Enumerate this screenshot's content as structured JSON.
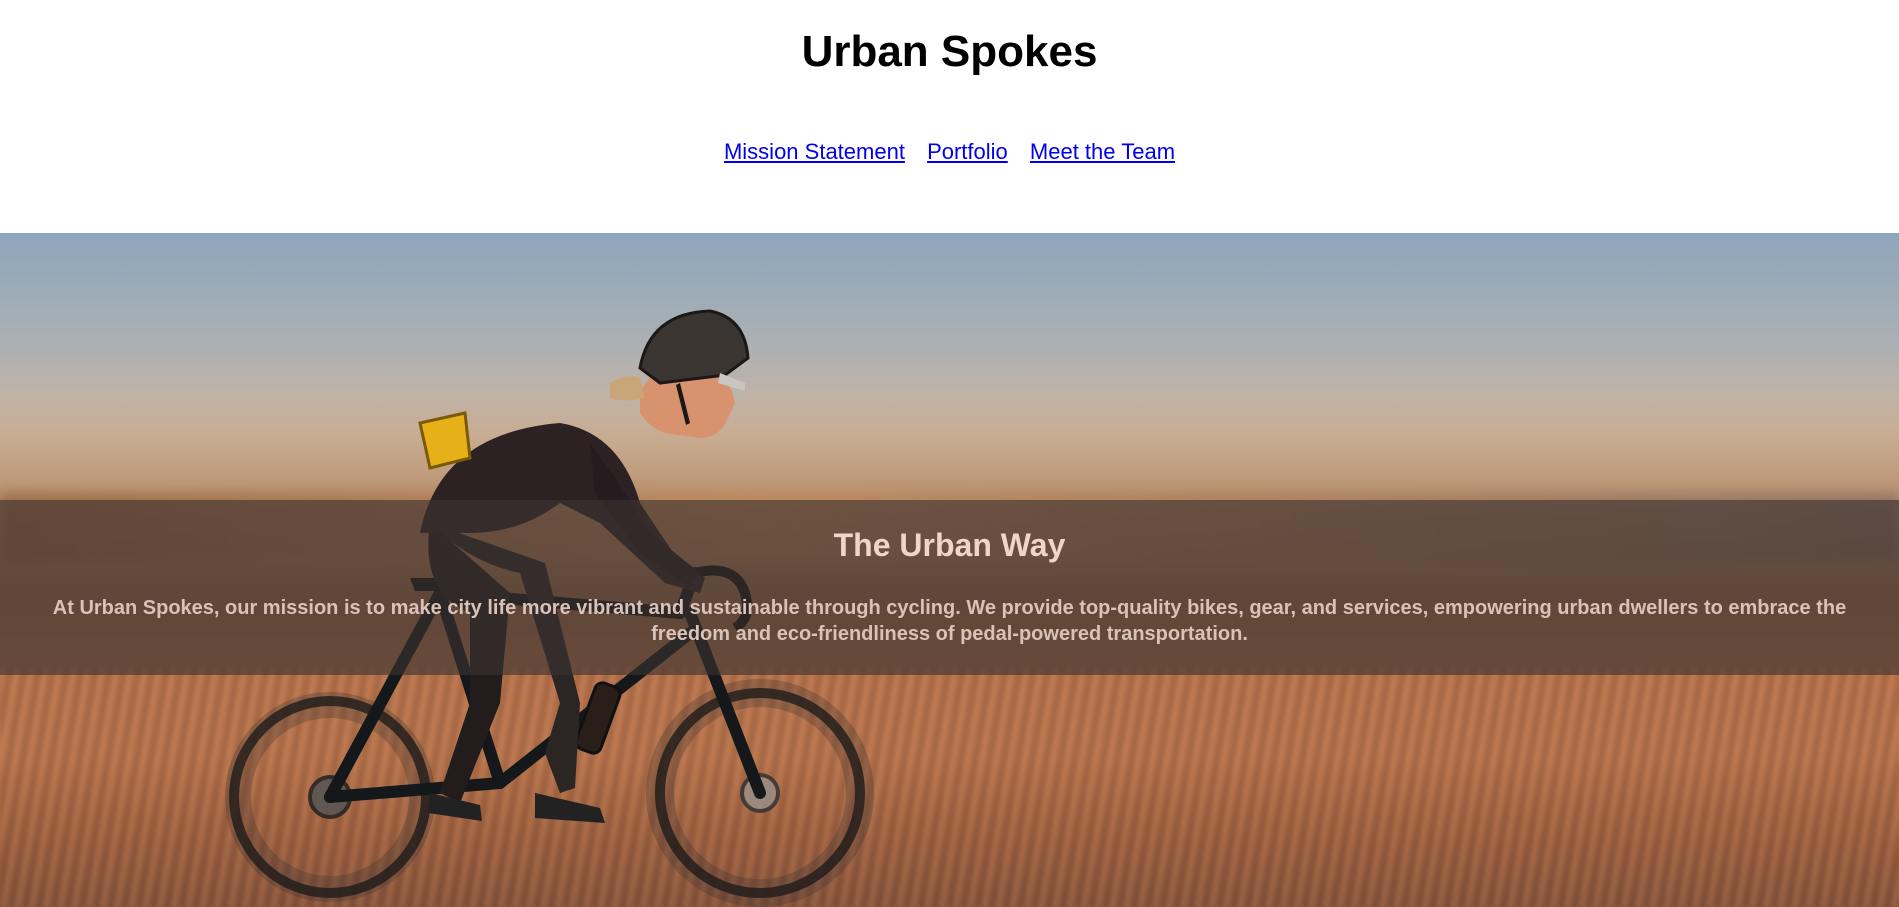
{
  "header": {
    "title": "Urban Spokes"
  },
  "nav": {
    "items": [
      {
        "label": "Mission Statement"
      },
      {
        "label": "Portfolio"
      },
      {
        "label": "Meet the Team"
      }
    ],
    "link_color": "#0000ee"
  },
  "hero": {
    "image_subject": "cyclist-riding-gravel-bike-at-sunset",
    "heading": "The Urban Way",
    "text": "At Urban Spokes, our mission is to make city life more vibrant and sustainable through cycling. We provide top-quality bikes, gear, and services, empowering urban dwellers to embrace the freedom and eco-friendliness of pedal-powered transportation."
  }
}
